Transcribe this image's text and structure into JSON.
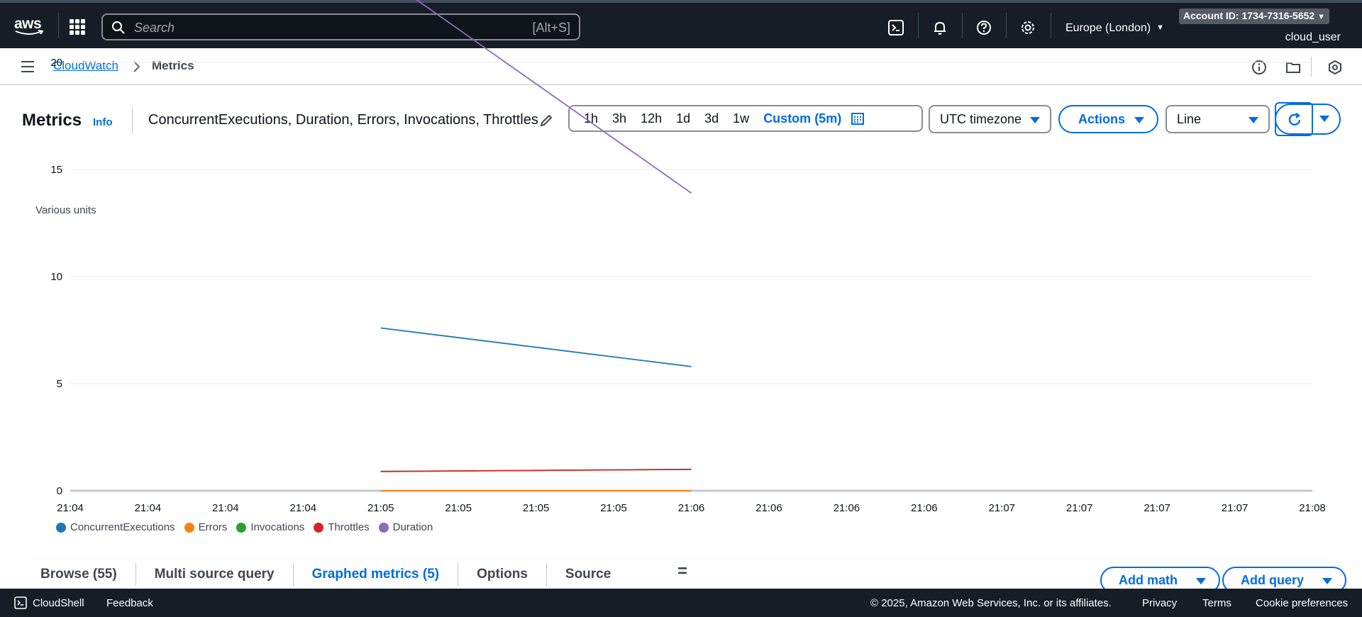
{
  "topnav": {
    "logo_text": "aws",
    "search_placeholder": "Search",
    "search_shortcut": "[Alt+S]",
    "region": "Europe (London)",
    "account": "Account ID: 1734-7316-5652",
    "user": "cloud_user"
  },
  "breadcrumb": {
    "service": "CloudWatch",
    "current": "Metrics"
  },
  "header": {
    "title": "Metrics",
    "info": "Info",
    "metrics_list": "ConcurrentExecutions, Duration, Errors, Invocations, Throttles",
    "time_ranges": [
      "1h",
      "3h",
      "12h",
      "1d",
      "3d",
      "1w"
    ],
    "custom_range": "Custom (5m)",
    "timezone": "UTC timezone",
    "actions": "Actions",
    "graph_type": "Line"
  },
  "chart_data": {
    "type": "line",
    "ylabel": "Various units",
    "x_ticks": [
      "21:04",
      "21:04",
      "21:04",
      "21:04",
      "21:05",
      "21:05",
      "21:05",
      "21:05",
      "21:06",
      "21:06",
      "21:06",
      "21:06",
      "21:07",
      "21:07",
      "21:07",
      "21:07",
      "21:08"
    ],
    "y_ticks": [
      0,
      5,
      10,
      15,
      20
    ],
    "ylim": [
      0,
      25
    ],
    "series": [
      {
        "name": "ConcurrentExecutions",
        "color": "#1f77b4",
        "x_index": [
          4,
          8
        ],
        "values": [
          7.6,
          5.8
        ]
      },
      {
        "name": "Errors",
        "color": "#ff7f0e",
        "x_index": [
          4,
          8
        ],
        "values": [
          0,
          0
        ]
      },
      {
        "name": "Invocations",
        "color": "#2ca02c",
        "x_index": [
          4,
          8
        ],
        "values": [
          0.9,
          1
        ]
      },
      {
        "name": "Throttles",
        "color": "#d62728",
        "x_index": [
          4,
          8
        ],
        "values": [
          0.9,
          1
        ]
      },
      {
        "name": "Duration",
        "color": "#9467bd",
        "x_index": [
          4,
          8
        ],
        "values": [
          24.1,
          13.9
        ]
      }
    ]
  },
  "tabs": [
    {
      "label": "Browse (55)"
    },
    {
      "label": "Multi source query"
    },
    {
      "label": "Graphed metrics (5)"
    },
    {
      "label": "Options"
    },
    {
      "label": "Source"
    }
  ],
  "buttons": {
    "add_math": "Add math",
    "add_query": "Add query"
  },
  "footer": {
    "cloudshell": "CloudShell",
    "feedback": "Feedback",
    "copyright": "© 2025, Amazon Web Services, Inc. or its affiliates.",
    "privacy": "Privacy",
    "terms": "Terms",
    "cookies": "Cookie preferences"
  }
}
